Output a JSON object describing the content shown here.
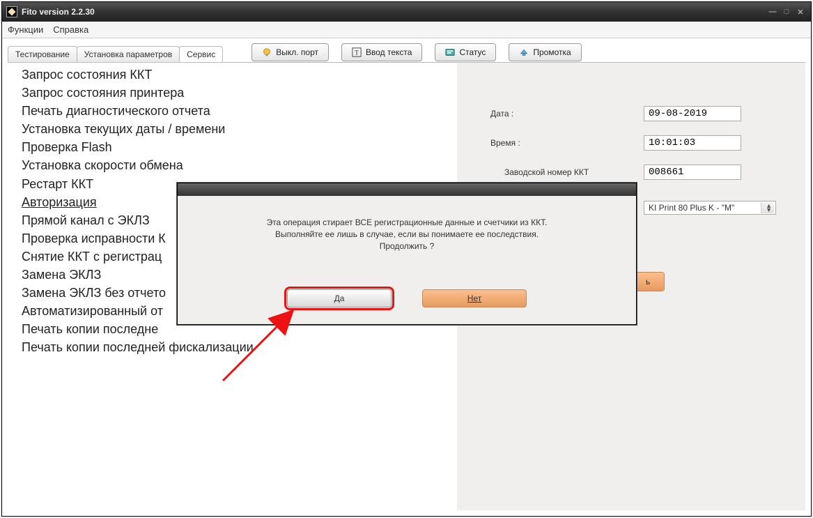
{
  "window": {
    "title": "Fito version 2.2.30"
  },
  "menubar": {
    "functions": "Функции",
    "help": "Справка"
  },
  "tabs": {
    "testing": "Тестирование",
    "params": "Установка параметров",
    "service": "Сервис"
  },
  "toolbar": {
    "port_off": "Выкл. порт",
    "enter_text": "Ввод текста",
    "status": "Статус",
    "feed": "Промотка"
  },
  "service_list": [
    "Запрос состояния ККТ",
    "Запрос состояния принтера",
    "Печать диагностического отчета",
    "Установка текущих даты / времени",
    "Проверка Flash",
    "Установка скорости обмена",
    "Рестарт ККТ",
    "Авторизация",
    "Прямой канал с ЭКЛЗ",
    "Проверка исправности К",
    "Снятие ККТ с регистрац",
    "Замена ЭКЛЗ",
    "Замена ЭКЛЗ без отчето",
    "Автоматизированный от",
    "Печать копии последне",
    "Печать копии последней фискализации"
  ],
  "right": {
    "date_label": "Дата :",
    "date_value": "09-08-2019",
    "time_label": "Время :",
    "time_value": "10:01:03",
    "serial_label": "Заводской номер ККТ",
    "serial_value": "008661",
    "model_value": "KI Print 80 Plus K  - \"М\"",
    "exec_btn": "ь"
  },
  "dialog": {
    "line1": "Эта операция стирает ВСЕ регистрационные данные и счетчики из ККТ.",
    "line2": "Выполняйте ее лишь в случае, если вы понимаете ее последствия.",
    "line3": "Продолжить ?",
    "yes": "Да",
    "no": "Нет"
  }
}
